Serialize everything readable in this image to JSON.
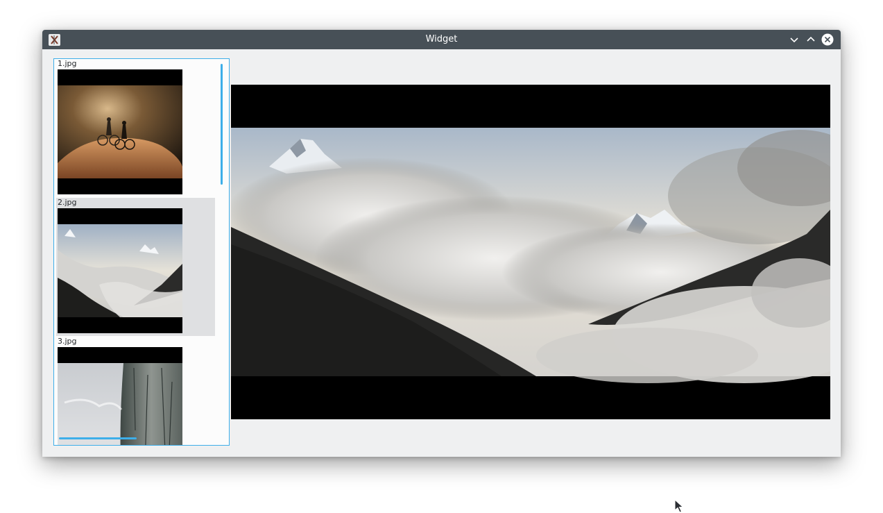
{
  "window": {
    "title": "Widget",
    "app_icon": "app-icon",
    "buttons": {
      "minimize": "chevron-down-icon",
      "maximize": "chevron-up-icon",
      "close": "close-icon"
    }
  },
  "image_list": {
    "items": [
      {
        "label": "1.jpg",
        "selected": false,
        "thumbnail": "bikers-on-rock"
      },
      {
        "label": "2.jpg",
        "selected": true,
        "thumbnail": "mountain-clouds"
      },
      {
        "label": "3.jpg",
        "selected": false,
        "thumbnail": "cliff-above-clouds"
      }
    ]
  },
  "preview": {
    "source": "2.jpg"
  },
  "colors": {
    "accent": "#3daee9",
    "titlebar": "#475057",
    "window_bg": "#eff0f1",
    "selection": "#dfe0e2"
  }
}
